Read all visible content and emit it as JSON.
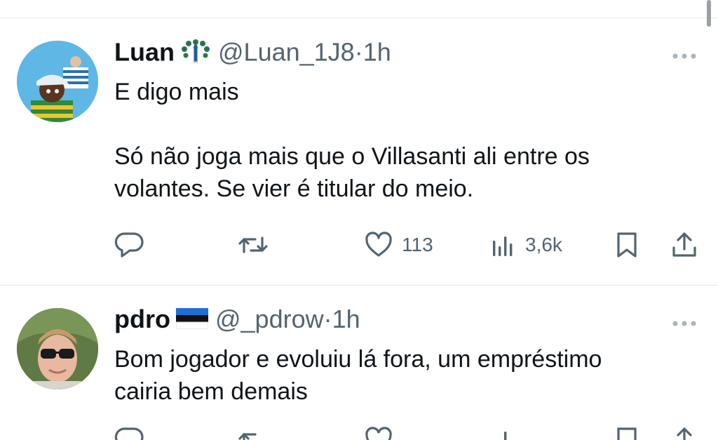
{
  "tweets": [
    {
      "name": "Luan",
      "handle": "@Luan_1J8",
      "dot": "·",
      "time": "1h",
      "badge": "peacock-emoji",
      "lines_p1": [
        "E digo mais"
      ],
      "lines_p2": [
        "Só não joga mais que o Villasanti ali entre os",
        "volantes. Se vier é titular do meio."
      ],
      "likes": "113",
      "views": "3,6k"
    },
    {
      "name": "pdro",
      "handle": "@_pdrow",
      "dot": "·",
      "time": "1h",
      "badge": "estonia-flag",
      "lines_p1": [
        "Bom jogador e evoluiu lá fora, um empréstimo",
        "cairia bem demais"
      ]
    }
  ],
  "colors": {
    "text": "#0f1419",
    "secondary": "#536471",
    "divider": "#e6e9ec"
  }
}
